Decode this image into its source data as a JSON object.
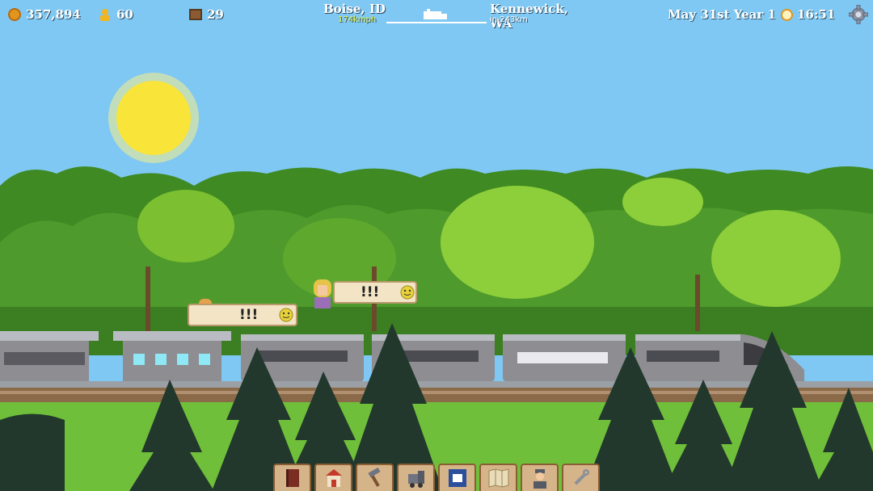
{
  "hud": {
    "money": "357,894",
    "passengers": "60",
    "cargo": "29",
    "coin_icon": "coin-icon",
    "passenger_icon": "passenger-icon",
    "cargo_icon": "cargo-crate-icon"
  },
  "route": {
    "from": "Boise, ID",
    "speed": "174kmph",
    "to": "Kennewick, WA",
    "distance": "in 243km"
  },
  "datetime": {
    "date": "May 31st Year 1",
    "time": "16:51"
  },
  "bubbles": [
    {
      "text": "!!!",
      "mood": "happy-face-icon"
    },
    {
      "text": "!!!",
      "mood": "happy-face-icon"
    }
  ],
  "toolbar": {
    "items": [
      "book-icon",
      "station-icon",
      "build-hammer-icon",
      "locomotive-icon",
      "train-card-icon",
      "map-icon",
      "crew-conductor-icon",
      "wrench-icon"
    ]
  },
  "colors": {
    "sky": "#7ec8f3",
    "sun": "#f9e43a",
    "foliage": "#4f9a2c",
    "train": "#8d8d92",
    "ui_panel": "#d6b48a"
  }
}
